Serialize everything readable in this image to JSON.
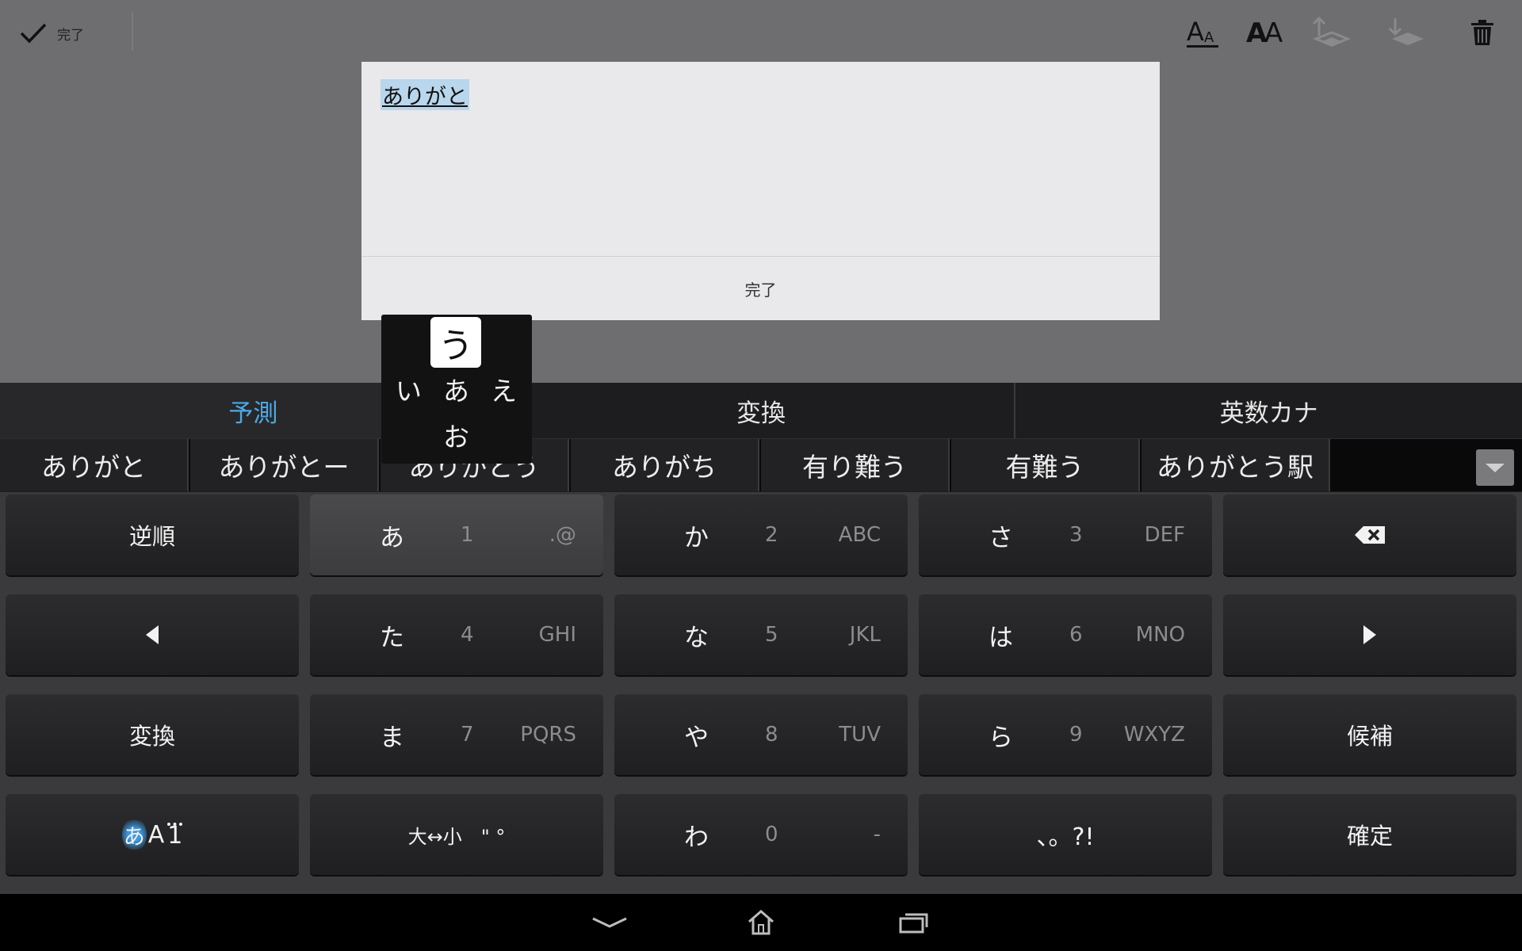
{
  "toolbar": {
    "done_label": "完了",
    "icons": [
      "checkmark-icon",
      "font-size-small-icon",
      "font-size-large-icon",
      "layer-up-icon",
      "layer-down-icon",
      "trash-icon"
    ]
  },
  "dialog": {
    "text": "ありがと",
    "done_label": "完了"
  },
  "keyboard": {
    "modes": [
      {
        "label": "予測",
        "active": true
      },
      {
        "label": "変換",
        "active": false
      },
      {
        "label": "英数カナ",
        "active": false
      }
    ],
    "candidates": [
      "ありがと",
      "ありがとー",
      "ありがとう",
      "ありがち",
      "有り難う",
      "有難う",
      "ありがとう駅"
    ],
    "flick": {
      "center": "あ",
      "up": "う",
      "left": "い",
      "right": "え",
      "down": "お"
    },
    "keys": {
      "reverse": "逆順",
      "a": {
        "kana": "あ",
        "num": "1",
        "alt": ".@"
      },
      "ka": {
        "kana": "か",
        "num": "2",
        "alt": "ABC"
      },
      "sa": {
        "kana": "さ",
        "num": "3",
        "alt": "DEF"
      },
      "ta": {
        "kana": "た",
        "num": "4",
        "alt": "GHI"
      },
      "na": {
        "kana": "な",
        "num": "5",
        "alt": "JKL"
      },
      "ha": {
        "kana": "は",
        "num": "6",
        "alt": "MNO"
      },
      "convert": "変換",
      "ma": {
        "kana": "ま",
        "num": "7",
        "alt": "PQRS"
      },
      "ya": {
        "kana": "や",
        "num": "8",
        "alt": "TUV"
      },
      "ra": {
        "kana": "ら",
        "num": "9",
        "alt": "WXYZ"
      },
      "candidates": "候補",
      "mode_kana": "あ",
      "mode_alpha": "A",
      "mode_num": "1",
      "size_toggle": "大↔小　\" °",
      "wa": {
        "kana": "わ",
        "num": "0",
        "alt": "-"
      },
      "punct": "、。?!",
      "confirm": "確定"
    }
  }
}
